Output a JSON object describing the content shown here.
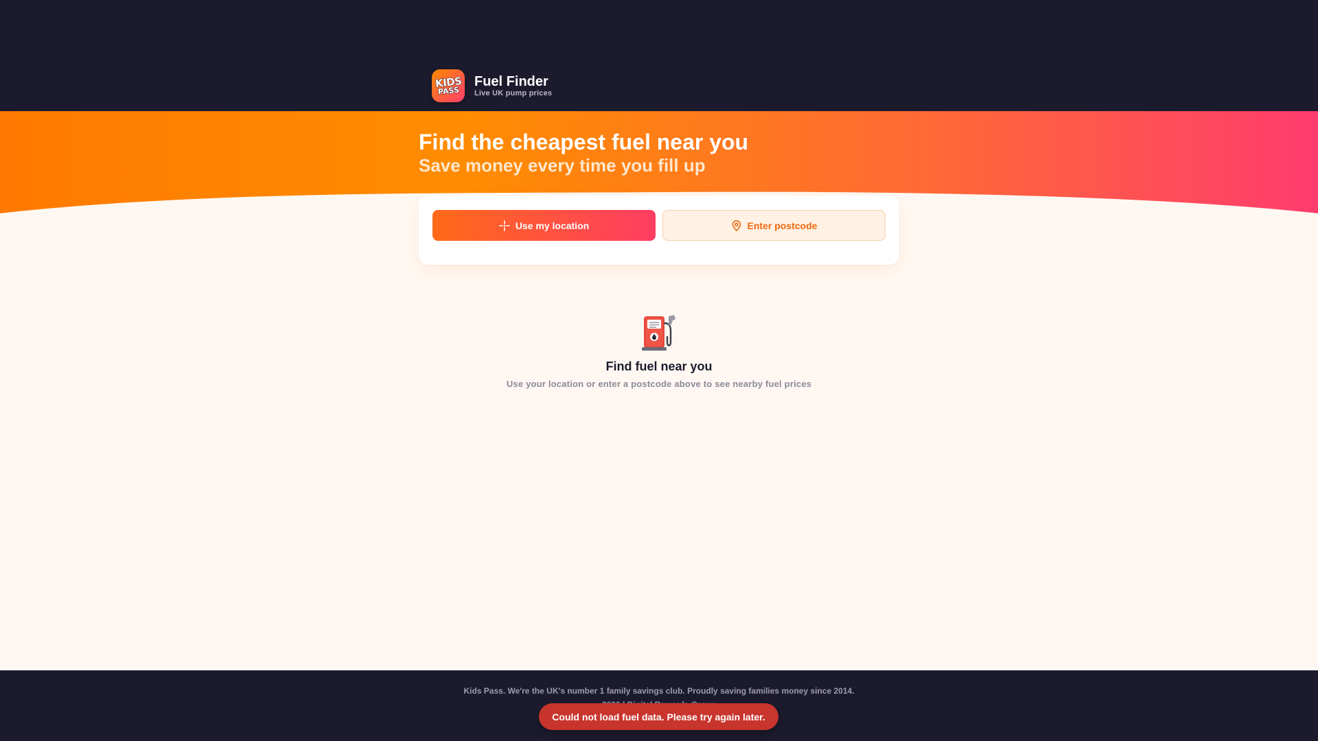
{
  "header": {
    "logo": {
      "line1": "KIDS",
      "line2": "PASS"
    },
    "title": "Fuel Finder",
    "subtitle": "Live UK pump prices"
  },
  "hero": {
    "title": "Find the cheapest fuel near you",
    "subtitle": "Save money every time you fill up"
  },
  "search": {
    "use_location_label": "Use my location",
    "use_location_icon": "crosshair-icon",
    "enter_postcode_label": "Enter postcode",
    "enter_postcode_icon": "map-pin-icon"
  },
  "empty_state": {
    "icon": "fuel-pump-icon",
    "title": "Find fuel near you",
    "description": "Use your location or enter a postcode above to see nearby fuel prices"
  },
  "footer": {
    "line1": "Kids Pass. We're the UK's number 1 family savings club. Proudly saving families money since 2014.",
    "line2": "2026 | Digital Rewards Group"
  },
  "toast": {
    "message": "Could not load fuel data. Please try again later."
  },
  "colors": {
    "header_bg": "#1c1b2e",
    "page_bg": "#fff8f2",
    "accent_orange": "#ff7a00",
    "accent_pink": "#ff3c6e",
    "error_red": "#c8352d"
  }
}
